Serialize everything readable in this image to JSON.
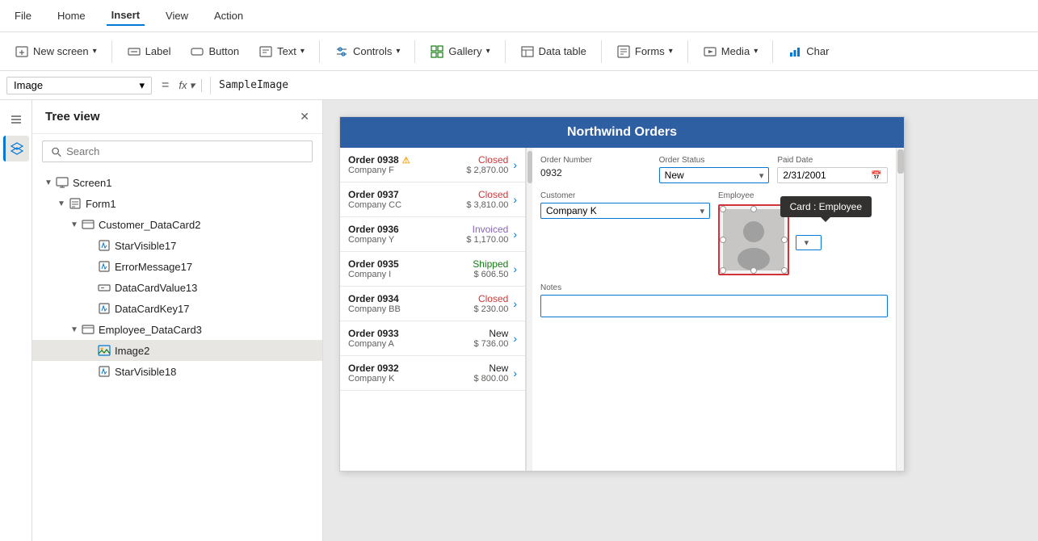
{
  "menu": {
    "items": [
      "File",
      "Home",
      "Insert",
      "View",
      "Action"
    ],
    "active": "Insert"
  },
  "toolbar": {
    "new_screen_label": "New screen",
    "label_label": "Label",
    "button_label": "Button",
    "text_label": "Text",
    "controls_label": "Controls",
    "gallery_label": "Gallery",
    "data_table_label": "Data table",
    "forms_label": "Forms",
    "media_label": "Media",
    "charts_label": "Char"
  },
  "formula_bar": {
    "selector_value": "Image",
    "eq_symbol": "=",
    "fx_label": "fx",
    "formula_value": "SampleImage"
  },
  "tree": {
    "title": "Tree view",
    "search_placeholder": "Search",
    "items": [
      {
        "id": "screen1",
        "label": "Screen1",
        "level": 0,
        "icon": "screen",
        "expanded": true
      },
      {
        "id": "form1",
        "label": "Form1",
        "level": 1,
        "icon": "form",
        "expanded": true
      },
      {
        "id": "customer_datacard2",
        "label": "Customer_DataCard2",
        "level": 2,
        "icon": "card",
        "expanded": true
      },
      {
        "id": "starvisible17",
        "label": "StarVisible17",
        "level": 3,
        "icon": "edit"
      },
      {
        "id": "errormessage17",
        "label": "ErrorMessage17",
        "level": 3,
        "icon": "edit"
      },
      {
        "id": "datacardvalue13",
        "label": "DataCardValue13",
        "level": 3,
        "icon": "input"
      },
      {
        "id": "datacardkey17",
        "label": "DataCardKey17",
        "level": 3,
        "icon": "edit"
      },
      {
        "id": "employee_datacard3",
        "label": "Employee_DataCard3",
        "level": 2,
        "icon": "card",
        "expanded": true
      },
      {
        "id": "image2",
        "label": "Image2",
        "level": 3,
        "icon": "image",
        "selected": true
      },
      {
        "id": "starvisible18",
        "label": "StarVisible18",
        "level": 3,
        "icon": "edit"
      }
    ]
  },
  "app": {
    "title": "Northwind Orders",
    "orders": [
      {
        "num": "Order 0938",
        "warn": true,
        "status": "Closed",
        "status_type": "closed",
        "company": "Company F",
        "amount": "$ 2,870.00"
      },
      {
        "num": "Order 0937",
        "warn": false,
        "status": "Closed",
        "status_type": "closed",
        "company": "Company CC",
        "amount": "$ 3,810.00"
      },
      {
        "num": "Order 0936",
        "warn": false,
        "status": "Invoiced",
        "status_type": "invoiced",
        "company": "Company Y",
        "amount": "$ 1,170.00"
      },
      {
        "num": "Order 0935",
        "warn": false,
        "status": "Shipped",
        "status_type": "shipped",
        "company": "Company I",
        "amount": "$ 606.50"
      },
      {
        "num": "Order 0934",
        "warn": false,
        "status": "Closed",
        "status_type": "closed",
        "company": "Company BB",
        "amount": "$ 230.00"
      },
      {
        "num": "Order 0933",
        "warn": false,
        "status": "New",
        "status_type": "new",
        "company": "Company A",
        "amount": "$ 736.00"
      },
      {
        "num": "Order 0932",
        "warn": false,
        "status": "New",
        "status_type": "new",
        "company": "Company K",
        "amount": "$ 800.00"
      }
    ],
    "detail": {
      "order_number_label": "Order Number",
      "order_number_value": "0932",
      "order_status_label": "Order Status",
      "order_status_value": "New",
      "paid_date_label": "Paid Date",
      "paid_date_value": "2/31/2001",
      "customer_label": "Customer",
      "customer_value": "Company K",
      "employee_label": "Employee",
      "notes_label": "Notes",
      "card_tooltip": "Card : Employee"
    }
  }
}
